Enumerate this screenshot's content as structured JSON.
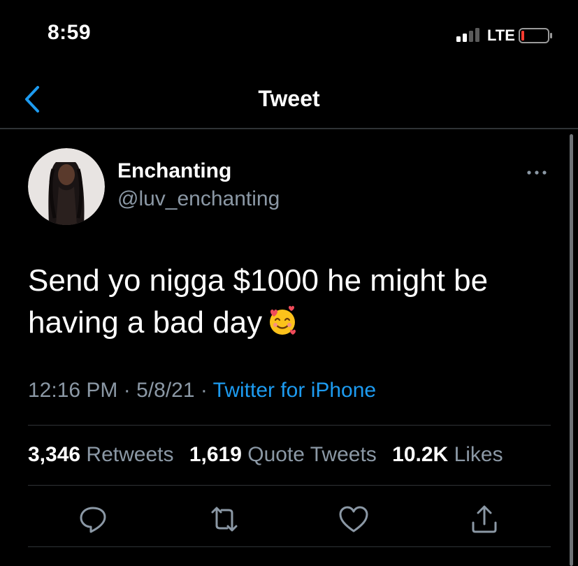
{
  "status_bar": {
    "time": "8:59",
    "network": "LTE"
  },
  "nav": {
    "title": "Tweet",
    "back_icon": "chevron-left-icon"
  },
  "author": {
    "display_name": "Enchanting",
    "handle": "@luv_enchanting"
  },
  "tweet": {
    "text": "Send yo nigga $1000 he might be having a bad day",
    "emoji": "smiling-face-with-hearts-icon",
    "time": "12:16 PM",
    "date": "5/8/21",
    "separator": "·",
    "source": "Twitter for iPhone"
  },
  "stats": {
    "retweets_count": "3,346",
    "retweets_label": "Retweets",
    "quotes_count": "1,619",
    "quotes_label": "Quote Tweets",
    "likes_count": "10.2K",
    "likes_label": "Likes"
  },
  "actions": [
    "reply-icon",
    "retweet-icon",
    "like-icon",
    "share-icon"
  ],
  "colors": {
    "background": "#000000",
    "accent": "#1d9bf0",
    "secondary_text": "#8b98a5",
    "divider": "#2f3336"
  }
}
